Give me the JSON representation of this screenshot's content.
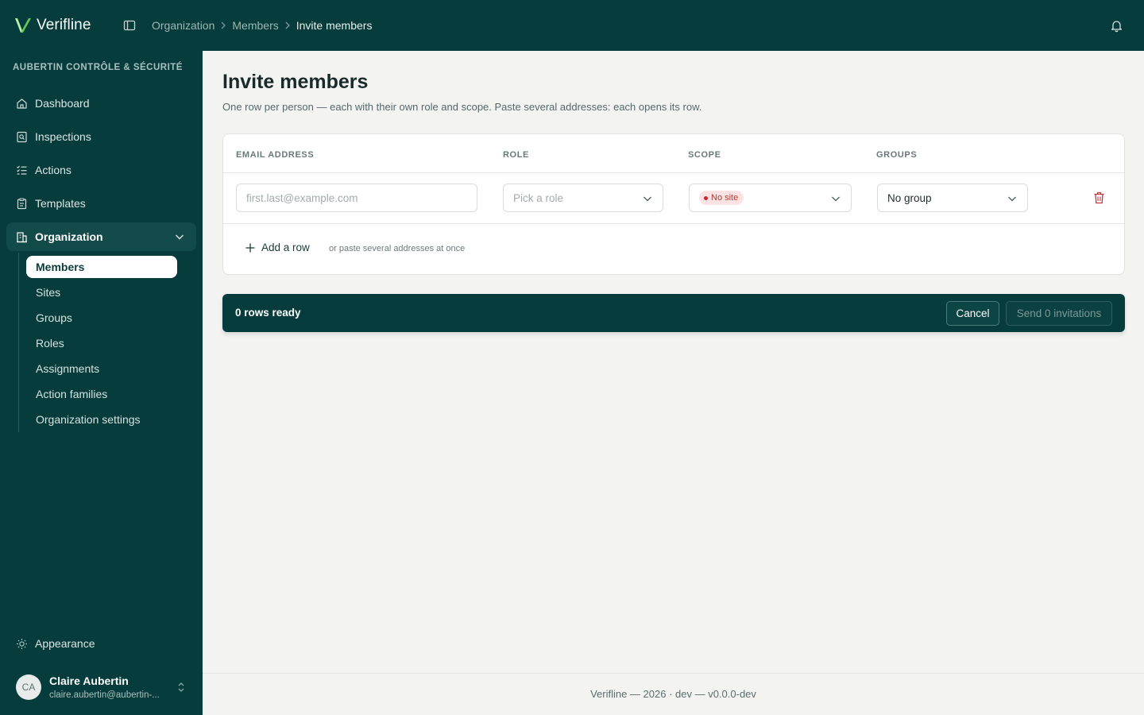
{
  "app": {
    "name": "Verifline"
  },
  "breadcrumb": [
    "Organization",
    "Members",
    "Invite members"
  ],
  "sidebar": {
    "org_name": "AUBERTIN CONTRÔLE & SÉCURITÉ",
    "items": [
      {
        "label": "Dashboard",
        "icon": "home-icon"
      },
      {
        "label": "Inspections",
        "icon": "clipboard-search-icon"
      },
      {
        "label": "Actions",
        "icon": "list-check-icon"
      },
      {
        "label": "Templates",
        "icon": "clipboard-icon"
      },
      {
        "label": "Organization",
        "icon": "building-icon",
        "expanded": true
      }
    ],
    "subitems": [
      {
        "label": "Members",
        "active": true
      },
      {
        "label": "Sites"
      },
      {
        "label": "Groups"
      },
      {
        "label": "Roles"
      },
      {
        "label": "Assignments"
      },
      {
        "label": "Action families"
      },
      {
        "label": "Organization settings"
      }
    ],
    "appearance": "Appearance",
    "user": {
      "initials": "CA",
      "name": "Claire Aubertin",
      "email": "claire.aubertin@aubertin-..."
    }
  },
  "page": {
    "title": "Invite members",
    "description": "One row per person — each with their own role and scope. Paste several addresses: each opens its row."
  },
  "table": {
    "headers": [
      "EMAIL ADDRESS",
      "ROLE",
      "SCOPE",
      "GROUPS"
    ],
    "row": {
      "email_placeholder": "first.last@example.com",
      "role_placeholder": "Pick a role",
      "scope_badge": "No site",
      "groups_value": "No group"
    },
    "add_row": "Add a row",
    "paste_hint": "or paste several addresses at once"
  },
  "action_bar": {
    "status": "0 rows ready",
    "cancel": "Cancel",
    "send": "Send 0 invitations"
  },
  "footer": "Verifline — 2026 · dev — v0.0.0-dev",
  "colors": {
    "sidebar": "#063c3c",
    "accent_green": "#7bd66b",
    "danger": "#c62b2b"
  }
}
